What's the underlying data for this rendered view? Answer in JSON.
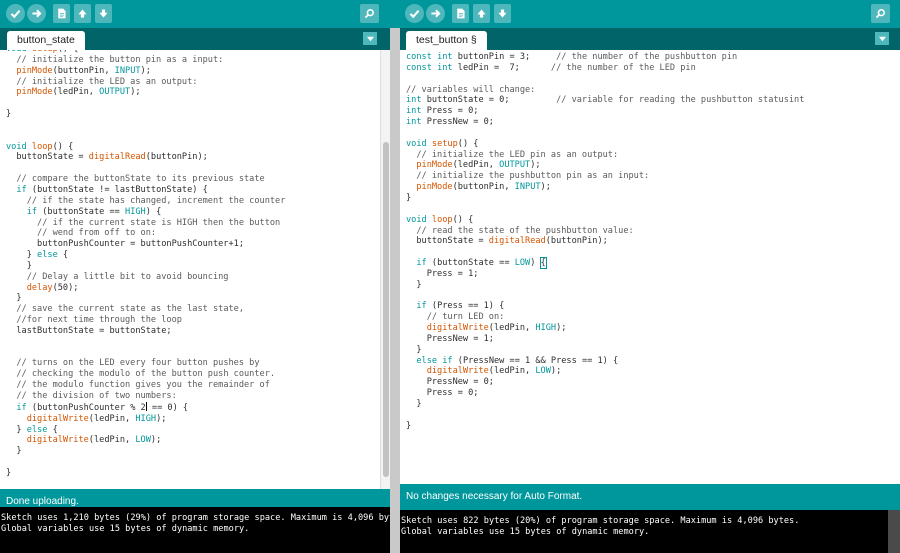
{
  "left_window": {
    "tab_label": "button_state",
    "status": "Done uploading.",
    "console_lines": [
      "Sketch uses 1,210 bytes (29%) of program storage space. Maximum is 4,096 bytes.",
      "Global variables use 15 bytes of dynamic memory."
    ]
  },
  "right_window": {
    "tab_label": "test_button §",
    "status": "No changes necessary for Auto Format.",
    "console_lines": [
      "Sketch uses 822 bytes (20%) of program storage space. Maximum is 4,096 bytes.",
      "Global variables use 15 bytes of dynamic memory."
    ]
  },
  "toolbar_icons": [
    "verify-icon",
    "upload-icon",
    "new-icon",
    "open-icon",
    "save-icon",
    "serial-monitor-icon"
  ],
  "colors": {
    "toolbar": "#00979c",
    "tabbar": "#006468",
    "button": "#4db7bb",
    "keyword": "#00979c",
    "function": "#d35400",
    "console_bg": "#000000"
  }
}
